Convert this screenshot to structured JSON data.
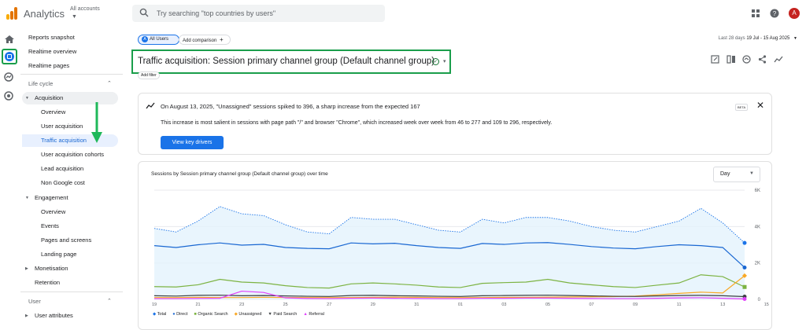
{
  "header": {
    "app_title": "Analytics",
    "accounts_label": "All accounts",
    "search_placeholder": "Try searching \"top countries by users\"",
    "avatar_letter": "A"
  },
  "sidebar": {
    "items": [
      {
        "label": "Reports snapshot"
      },
      {
        "label": "Realtime overview"
      },
      {
        "label": "Realtime pages"
      }
    ],
    "lifecycle_label": "Life cycle",
    "acquisition_label": "Acquisition",
    "acquisition_items": [
      "Overview",
      "User acquisition",
      "Traffic acquisition",
      "User acquisition cohorts",
      "Lead acquisition",
      "Non Google cost"
    ],
    "engagement_label": "Engagement",
    "engagement_items": [
      "Overview",
      "Events",
      "Pages and screens",
      "Landing page"
    ],
    "monetisation_label": "Monetisation",
    "retention_label": "Retention",
    "user_section_label": "User",
    "user_attributes_label": "User attributes"
  },
  "toolbar": {
    "all_users_chip": "All Users",
    "all_users_letter": "A",
    "add_comparison": "Add comparison",
    "date_prefix": "Last 28 days",
    "date_range": "19 Jul - 15 Aug 2025",
    "page_title": "Traffic acquisition: Session primary channel group (Default channel group)",
    "add_filter": "Add filter"
  },
  "insight": {
    "headline": "On August 13, 2025, \"Unassigned\" sessions spiked to 396, a sharp increase from the expected 167",
    "detail": "This increase is most salient in sessions with page path \"/\" and browser \"Chrome\", which increased week over week from 46 to 277 and 109 to 296, respectively.",
    "button": "View key drivers",
    "badge": "BETA"
  },
  "chart": {
    "title": "Sessions by Session primary channel group (Default channel group) over time",
    "granularity": "Day",
    "legend": [
      "Total",
      "Direct",
      "Organic Search",
      "Unassigned",
      "Paid Search",
      "Referral"
    ]
  },
  "colors": {
    "accent": "#1a73e8",
    "highlight_green": "#1a9e4b",
    "total": "#1a73e8",
    "direct": "#1967d2",
    "organic": "#7cb342",
    "unassigned": "#f9a825",
    "paid": "#3c4043",
    "referral": "#e040fb"
  },
  "chart_data": {
    "type": "line",
    "x": [
      "19 Jul",
      "20 Jul",
      "21 Jul",
      "22 Jul",
      "23 Jul",
      "24 Jul",
      "25 Jul",
      "26 Jul",
      "27 Jul",
      "28 Jul",
      "29 Jul",
      "30 Jul",
      "31 Jul",
      "01 Aug",
      "02 Aug",
      "03 Aug",
      "04 Aug",
      "05 Aug",
      "06 Aug",
      "07 Aug",
      "08 Aug",
      "09 Aug",
      "10 Aug",
      "11 Aug",
      "12 Aug",
      "13 Aug",
      "14 Aug",
      "15 Aug"
    ],
    "xticks": [
      "19 Jul",
      "21",
      "23",
      "25",
      "27",
      "29",
      "31",
      "01 Aug",
      "03",
      "05",
      "07",
      "09",
      "11",
      "13",
      "15"
    ],
    "ylim": [
      0,
      6000
    ],
    "yticks": [
      "0",
      "2K",
      "4K",
      "6K"
    ],
    "series": [
      {
        "name": "Total",
        "values": [
          3900,
          3700,
          4300,
          5100,
          4700,
          4600,
          4100,
          3700,
          3600,
          4500,
          4400,
          4400,
          4100,
          3800,
          3700,
          4400,
          4200,
          4500,
          4500,
          4300,
          4000,
          3800,
          3700,
          4000,
          4300,
          5000,
          4200,
          3100
        ]
      },
      {
        "name": "Direct",
        "values": [
          2950,
          2850,
          3000,
          3100,
          2980,
          3020,
          2850,
          2800,
          2780,
          3100,
          3050,
          3080,
          2950,
          2850,
          2800,
          3070,
          3020,
          3100,
          3120,
          3020,
          2900,
          2820,
          2780,
          2900,
          3000,
          2950,
          2850,
          1750
        ]
      },
      {
        "name": "Organic Search",
        "values": [
          700,
          680,
          800,
          1100,
          950,
          900,
          750,
          650,
          620,
          850,
          900,
          850,
          780,
          680,
          650,
          880,
          920,
          950,
          1100,
          900,
          800,
          700,
          650,
          780,
          900,
          1350,
          1250,
          680
        ]
      },
      {
        "name": "Unassigned",
        "values": [
          100,
          100,
          110,
          100,
          100,
          110,
          100,
          100,
          100,
          100,
          110,
          120,
          110,
          100,
          100,
          100,
          110,
          110,
          120,
          130,
          140,
          150,
          180,
          250,
          330,
          396,
          350,
          1300
        ]
      },
      {
        "name": "Paid Search",
        "values": [
          200,
          180,
          220,
          230,
          200,
          210,
          190,
          170,
          160,
          210,
          220,
          200,
          190,
          170,
          160,
          200,
          210,
          220,
          230,
          210,
          190,
          170,
          160,
          190,
          210,
          220,
          200,
          150
        ]
      },
      {
        "name": "Referral",
        "values": [
          40,
          40,
          50,
          60,
          450,
          380,
          80,
          50,
          40,
          60,
          70,
          60,
          50,
          40,
          40,
          60,
          60,
          70,
          70,
          60,
          50,
          40,
          40,
          60,
          80,
          90,
          60,
          20
        ]
      }
    ]
  }
}
